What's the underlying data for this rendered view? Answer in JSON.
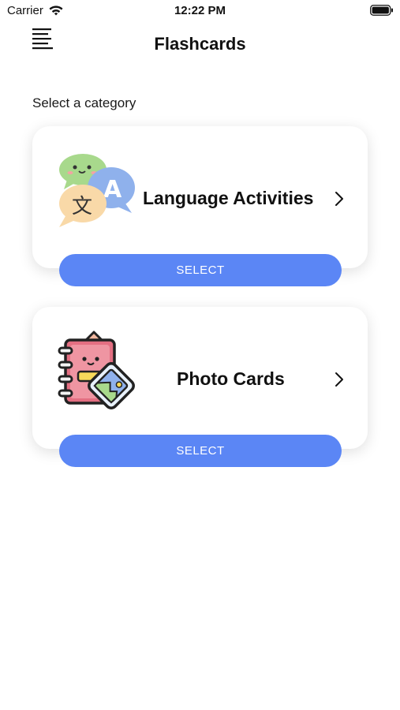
{
  "status_bar": {
    "carrier": "Carrier",
    "time": "12:22 PM",
    "icons": [
      "wifi-icon",
      "battery-icon"
    ]
  },
  "nav": {
    "title": "Flashcards",
    "menu_icon": "menu-lines-icon"
  },
  "main": {
    "section_label": "Select a category",
    "categories": [
      {
        "label": "Language Activities",
        "icon": "language-speech-bubbles-icon",
        "button_label": "SELECT"
      },
      {
        "label": "Photo Cards",
        "icon": "photo-notebook-icon",
        "button_label": "SELECT"
      }
    ]
  },
  "colors": {
    "accent": "#5b86f5",
    "background": "#ffffff",
    "card_background": "#ffffff"
  }
}
